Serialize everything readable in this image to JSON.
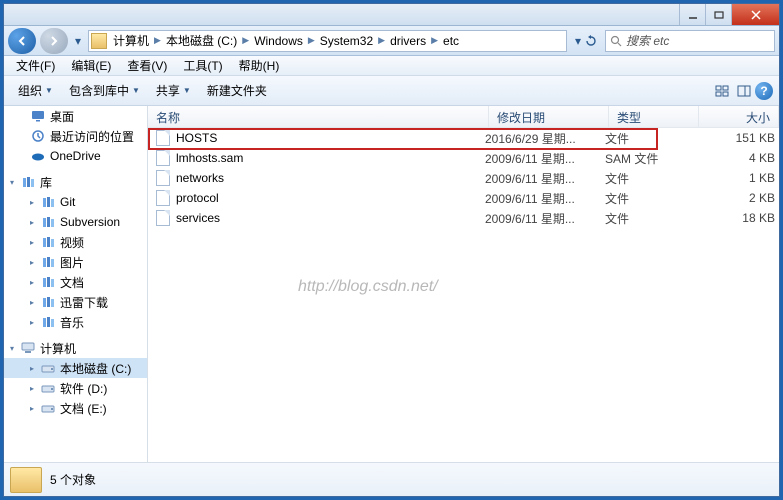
{
  "address": {
    "crumbs": [
      "计算机",
      "本地磁盘 (C:)",
      "Windows",
      "System32",
      "drivers",
      "etc"
    ]
  },
  "search": {
    "placeholder": "搜索 etc"
  },
  "menu": {
    "file": "文件(F)",
    "edit": "编辑(E)",
    "view": "查看(V)",
    "tools": "工具(T)",
    "help": "帮助(H)"
  },
  "toolbar": {
    "organize": "组织",
    "include": "包含到库中",
    "share": "共享",
    "newfolder": "新建文件夹"
  },
  "columns": {
    "name": "名称",
    "date": "修改日期",
    "type": "类型",
    "size": "大小"
  },
  "files": [
    {
      "name": "HOSTS",
      "date": "2016/6/29 星期...",
      "type": "文件",
      "size": "151 KB"
    },
    {
      "name": "lmhosts.sam",
      "date": "2009/6/11 星期...",
      "type": "SAM 文件",
      "size": "4 KB"
    },
    {
      "name": "networks",
      "date": "2009/6/11 星期...",
      "type": "文件",
      "size": "1 KB"
    },
    {
      "name": "protocol",
      "date": "2009/6/11 星期...",
      "type": "文件",
      "size": "2 KB"
    },
    {
      "name": "services",
      "date": "2009/6/11 星期...",
      "type": "文件",
      "size": "18 KB"
    }
  ],
  "sidebar": {
    "section1": [
      {
        "label": "桌面",
        "icon": "desktop"
      },
      {
        "label": "最近访问的位置",
        "icon": "recent"
      },
      {
        "label": "OneDrive",
        "icon": "onedrive"
      }
    ],
    "library_hdr": "库",
    "libraries": [
      {
        "label": "Git",
        "icon": "git"
      },
      {
        "label": "Subversion",
        "icon": "svn"
      },
      {
        "label": "视频",
        "icon": "video"
      },
      {
        "label": "图片",
        "icon": "pic"
      },
      {
        "label": "文档",
        "icon": "doc"
      },
      {
        "label": "迅雷下载",
        "icon": "thunder"
      },
      {
        "label": "音乐",
        "icon": "music"
      }
    ],
    "computer_hdr": "计算机",
    "drives": [
      {
        "label": "本地磁盘 (C:)",
        "selected": true
      },
      {
        "label": "软件 (D:)"
      },
      {
        "label": "文档 (E:)"
      }
    ]
  },
  "status": {
    "text": "5 个对象"
  },
  "watermark": "http://blog.csdn.net/"
}
